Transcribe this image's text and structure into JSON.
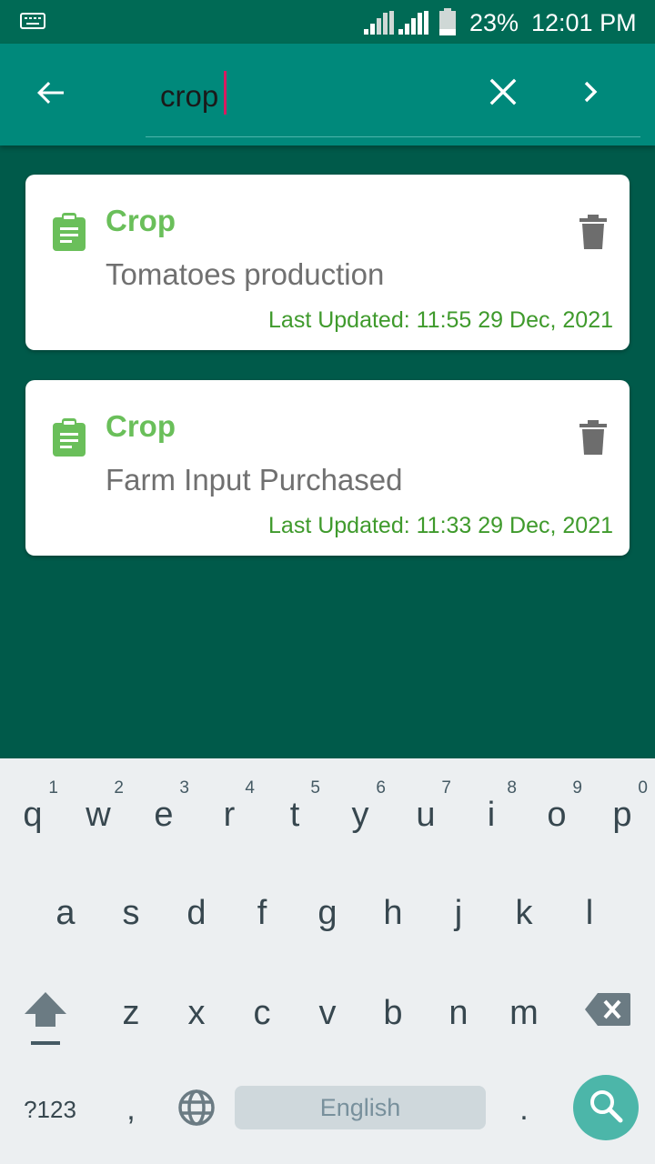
{
  "status_bar": {
    "battery_percent": "23%",
    "time": "12:01 PM",
    "icons": [
      "keyboard-icon",
      "signal-icon",
      "signal-icon",
      "battery-icon"
    ]
  },
  "app_bar": {
    "search_value": "crop",
    "icons": [
      "arrow-back-icon",
      "close-icon",
      "chevron-right-icon"
    ],
    "background_color": "#00897b"
  },
  "results": [
    {
      "category": "Crop",
      "title": "Tomatoes production",
      "updated": "Last Updated: 11:55 29 Dec, 2021"
    },
    {
      "category": "Crop",
      "title": "Farm Input Purchased",
      "updated": "Last Updated: 11:33 29 Dec, 2021"
    }
  ],
  "keyboard": {
    "row1": [
      {
        "key": "q",
        "hint": "1"
      },
      {
        "key": "w",
        "hint": "2"
      },
      {
        "key": "e",
        "hint": "3"
      },
      {
        "key": "r",
        "hint": "4"
      },
      {
        "key": "t",
        "hint": "5"
      },
      {
        "key": "y",
        "hint": "6"
      },
      {
        "key": "u",
        "hint": "7"
      },
      {
        "key": "i",
        "hint": "8"
      },
      {
        "key": "o",
        "hint": "9"
      },
      {
        "key": "p",
        "hint": "0"
      }
    ],
    "row2": [
      "a",
      "s",
      "d",
      "f",
      "g",
      "h",
      "j",
      "k",
      "l"
    ],
    "row3": [
      "z",
      "x",
      "c",
      "v",
      "b",
      "n",
      "m"
    ],
    "symbols_label": "?123",
    "comma": ",",
    "space_label": "English",
    "period": ".",
    "accent_color": "#4cb6a9"
  }
}
